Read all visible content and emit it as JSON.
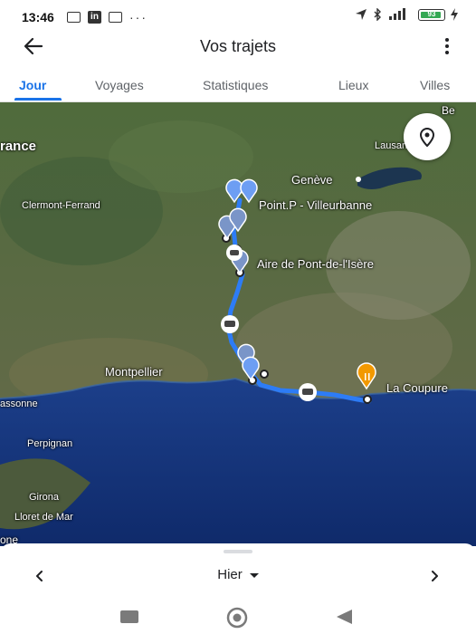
{
  "status_bar": {
    "time": "13:46",
    "left_icons": [
      "message-icon",
      "linkedin-icon",
      "message-icon",
      "more-dots-icon"
    ],
    "overflow_dots": "···",
    "right_icons": [
      "location-arrow-icon",
      "bluetooth-icon",
      "signal-icon",
      "battery-icon",
      "charging-icon"
    ],
    "battery_level": 0.9,
    "battery_text": "93"
  },
  "app_bar": {
    "back_icon": "arrow-left-icon",
    "title": "Vos trajets",
    "more_icon": "more-vert-icon"
  },
  "tabs": [
    {
      "label": "Jour",
      "active": true
    },
    {
      "label": "Voyages",
      "active": false
    },
    {
      "label": "Statistiques",
      "active": false
    },
    {
      "label": "Lieux",
      "active": false
    },
    {
      "label": "Villes",
      "active": false
    }
  ],
  "map": {
    "labels": {
      "france": "rance",
      "lausanne": "Lausanne",
      "geneve": "Genève",
      "clermont": "Clermont-Ferrand",
      "villeurbanne": "Point.P - Villeurbanne",
      "aire": "Aire de Pont-de-l'Isère",
      "montpellier": "Montpellier",
      "coupure": "La Coupure",
      "carcassonne": "assonne",
      "perpignan": "Perpignan",
      "girona": "Girona",
      "lloret": "Lloret de Mar",
      "barcelona": "one",
      "be": "Be"
    },
    "route_color": "#2d7cf6",
    "locate_icon": "map-pin-icon",
    "markers": [
      "gallery-marker-icon",
      "car-marker-icon",
      "restaurant-marker-icon",
      "place-marker-icon"
    ]
  },
  "bottom_sheet": {
    "prev_icon": "chevron-left-icon",
    "day_label": "Hier",
    "next_icon": "chevron-right-icon"
  },
  "nav_bar": {
    "icons": [
      "recents-square-icon",
      "home-circle-icon",
      "back-triangle-icon"
    ]
  }
}
